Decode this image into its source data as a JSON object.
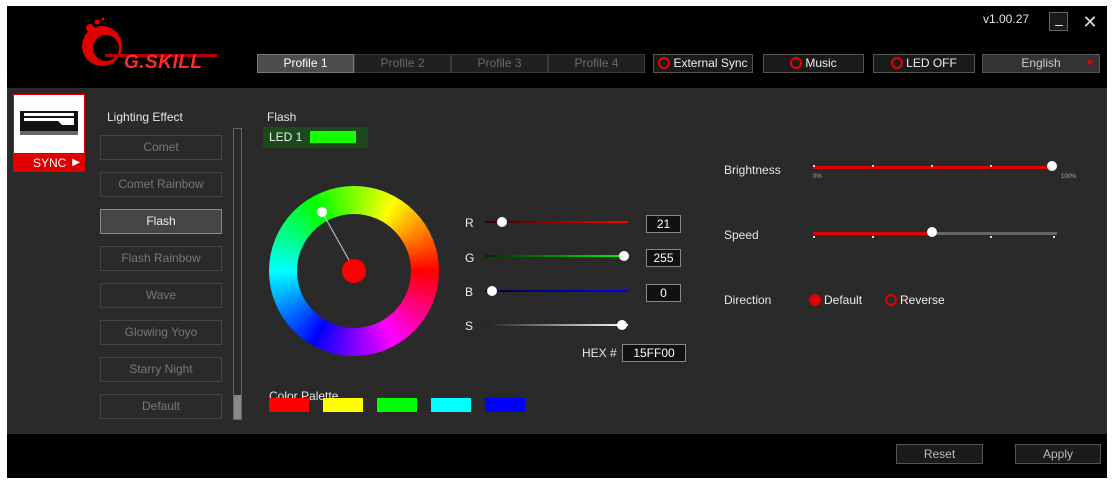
{
  "app": {
    "version": "v1.00.27",
    "logo_text": "G.SKILL"
  },
  "window_controls": {
    "minimize": "_",
    "close": "✕"
  },
  "profiles": [
    "Profile 1",
    "Profile 2",
    "Profile 3",
    "Profile 4"
  ],
  "header_buttons": {
    "external_sync": "External Sync",
    "music": "Music",
    "led_off": "LED OFF"
  },
  "language": {
    "selected": "English",
    "arrow": "▼"
  },
  "device": {
    "sync_label": "SYNC",
    "arrow": "▶"
  },
  "lighting": {
    "title": "Lighting Effect",
    "effects": [
      "Comet",
      "Comet Rainbow",
      "Flash",
      "Flash Rainbow",
      "Wave",
      "Glowing Yoyo",
      "Starry Night",
      "Default"
    ],
    "selected_index": 2
  },
  "flash": {
    "title": "Flash",
    "led_label": "LED 1",
    "led_color": "#15FF00"
  },
  "color": {
    "r_label": "R",
    "g_label": "G",
    "b_label": "B",
    "s_label": "S",
    "r": "21",
    "g": "255",
    "b": "0",
    "hex_label": "HEX #",
    "hex": "15FF00"
  },
  "palette": {
    "title": "Color Palette",
    "colors": [
      "#ff0000",
      "#ffff00",
      "#00ff00",
      "#00ffff",
      "#0000ff"
    ]
  },
  "brightness": {
    "label": "Brightness",
    "min_label": "0%",
    "max_label": "100%",
    "value_fraction": 1.0
  },
  "speed": {
    "label": "Speed",
    "value_fraction": 0.5
  },
  "direction": {
    "label": "Direction",
    "default_label": "Default",
    "reverse_label": "Reverse",
    "selected": "Default"
  },
  "footer": {
    "reset": "Reset",
    "apply": "Apply"
  },
  "accent": "#e00000"
}
